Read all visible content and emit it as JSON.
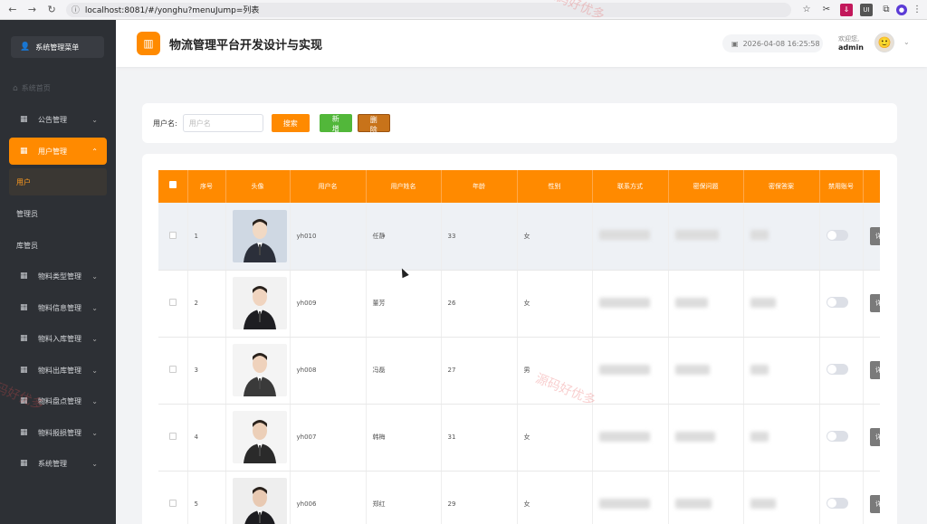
{
  "browser": {
    "url": "localhost:8081/#/yonghu?menuJump=列表"
  },
  "sidebar": {
    "header": "系统管理菜单",
    "home": "系统首页",
    "items": [
      {
        "label": "公告管理"
      },
      {
        "label": "用户管理"
      },
      {
        "label": "物料类型管理"
      },
      {
        "label": "物料信息管理"
      },
      {
        "label": "物料入库管理"
      },
      {
        "label": "物料出库管理"
      },
      {
        "label": "物料盘点管理"
      },
      {
        "label": "物料报损管理"
      },
      {
        "label": "系统管理"
      }
    ],
    "sub_items": [
      {
        "label": "用户"
      },
      {
        "label": "管理员"
      },
      {
        "label": "库管员"
      }
    ]
  },
  "header": {
    "title": "物流管理平台开发设计与实现",
    "datetime": "2026-04-08 16:25:58",
    "welcome": "欢迎您,",
    "username": "admin"
  },
  "search": {
    "label": "用户名:",
    "placeholder": "用户名",
    "search_btn": "搜索",
    "add_btn": "新增",
    "delete_btn": "删除"
  },
  "table": {
    "headers": [
      "序号",
      "头像",
      "用户名",
      "用户姓名",
      "年龄",
      "性别",
      "联系方式",
      "密保问题",
      "密保答案",
      "禁用账号"
    ],
    "rows": [
      {
        "no": "1",
        "username": "yh010",
        "name": "任静",
        "age": "33",
        "gender": "女"
      },
      {
        "no": "2",
        "username": "yh009",
        "name": "董芳",
        "age": "26",
        "gender": "女"
      },
      {
        "no": "3",
        "username": "yh008",
        "name": "冯磊",
        "age": "27",
        "gender": "男"
      },
      {
        "no": "4",
        "username": "yh007",
        "name": "韩梅",
        "age": "31",
        "gender": "女"
      },
      {
        "no": "5",
        "username": "yh006",
        "name": "郑红",
        "age": "29",
        "gender": "女"
      }
    ],
    "op_label": "详"
  },
  "watermark": "源码好优多",
  "colors": {
    "accent": "#ff8a00",
    "sidebar_bg": "#2d3035",
    "add_btn": "#52b73a",
    "delete_btn": "#c8731a"
  }
}
